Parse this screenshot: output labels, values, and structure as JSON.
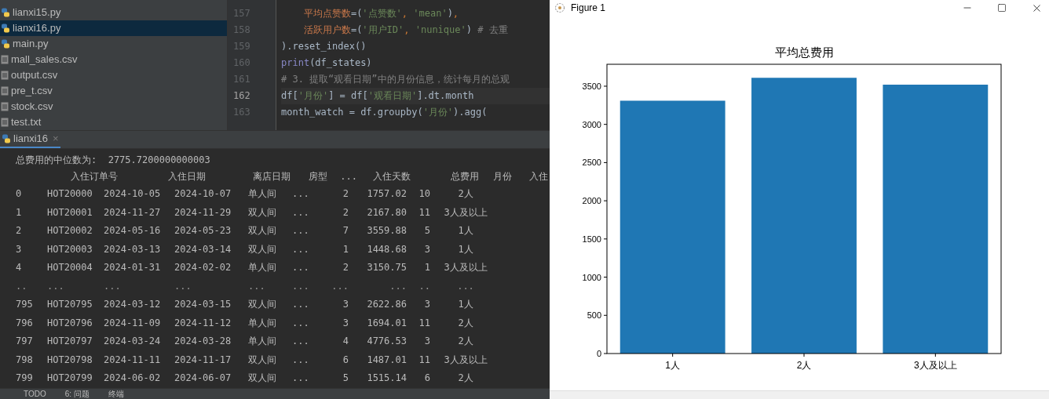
{
  "project_tree": {
    "items": [
      {
        "name": "lianxi15.py",
        "kind": "py",
        "selected": false
      },
      {
        "name": "lianxi16.py",
        "kind": "py",
        "selected": true
      },
      {
        "name": "main.py",
        "kind": "py",
        "selected": false
      },
      {
        "name": "mall_sales.csv",
        "kind": "file",
        "selected": false
      },
      {
        "name": "output.csv",
        "kind": "file",
        "selected": false
      },
      {
        "name": "pre_t.csv",
        "kind": "file",
        "selected": false
      },
      {
        "name": "stock.csv",
        "kind": "file",
        "selected": false
      },
      {
        "name": "test.txt",
        "kind": "file",
        "selected": false
      }
    ]
  },
  "editor": {
    "lines": [
      {
        "number": "157",
        "current": false,
        "tokens": [
          {
            "text": "    平均点赞数",
            "kind": "param"
          },
          {
            "text": "=(",
            "kind": "plain"
          },
          {
            "text": "'点赞数'",
            "kind": "str"
          },
          {
            "text": ", ",
            "kind": "punct"
          },
          {
            "text": "'mean'",
            "kind": "str"
          },
          {
            "text": ")",
            "kind": "plain"
          },
          {
            "text": ",",
            "kind": "punct"
          }
        ]
      },
      {
        "number": "158",
        "current": false,
        "tokens": [
          {
            "text": "    活跃用户数",
            "kind": "param"
          },
          {
            "text": "=(",
            "kind": "plain"
          },
          {
            "text": "'用户ID'",
            "kind": "str"
          },
          {
            "text": ", ",
            "kind": "punct"
          },
          {
            "text": "'nunique'",
            "kind": "str"
          },
          {
            "text": ")",
            "kind": "plain"
          },
          {
            "text": " # 去重",
            "kind": "comment"
          }
        ]
      },
      {
        "number": "159",
        "current": false,
        "tokens": [
          {
            "text": ").reset_index()",
            "kind": "plain"
          }
        ]
      },
      {
        "number": "160",
        "current": false,
        "tokens": [
          {
            "text": "print",
            "kind": "builtin"
          },
          {
            "text": "(df_states)",
            "kind": "plain"
          }
        ]
      },
      {
        "number": "161",
        "current": false,
        "tokens": [
          {
            "text": "# 3. 提取“观看日期”中的月份信息，统计每月的总观",
            "kind": "comment"
          }
        ]
      },
      {
        "number": "162",
        "current": true,
        "tokens": [
          {
            "text": "df[",
            "kind": "plain"
          },
          {
            "text": "'月份'",
            "kind": "str"
          },
          {
            "text": "] = df[",
            "kind": "plain"
          },
          {
            "text": "'观看日期'",
            "kind": "str"
          },
          {
            "text": "].dt.month",
            "kind": "plain"
          }
        ]
      },
      {
        "number": "163",
        "current": false,
        "tokens": [
          {
            "text": "month_watch = df.groupby(",
            "kind": "plain"
          },
          {
            "text": "'月份'",
            "kind": "str"
          },
          {
            "text": ").agg(",
            "kind": "plain"
          }
        ]
      }
    ]
  },
  "run_tab": {
    "label": "lianxi16",
    "close": "×"
  },
  "console": {
    "message": "总费用的中位数为:  2775.7200000000003",
    "header": [
      "入住订单号",
      "入住日期",
      "离店日期",
      "房型",
      "...",
      "入住天数",
      "总费用",
      "月份",
      "入住"
    ],
    "rows": [
      {
        "kind": "data",
        "cells": [
          "0",
          "HOT20000",
          "2024-10-05",
          "2024-10-07",
          "单人间",
          "...",
          "2",
          "1757.02",
          "10",
          "2人"
        ]
      },
      {
        "kind": "data",
        "cells": [
          "1",
          "HOT20001",
          "2024-11-27",
          "2024-11-29",
          "双人间",
          "...",
          "2",
          "2167.80",
          "11",
          "3人及以上"
        ]
      },
      {
        "kind": "data",
        "cells": [
          "2",
          "HOT20002",
          "2024-05-16",
          "2024-05-23",
          "双人间",
          "...",
          "7",
          "3559.88",
          "5",
          "1人"
        ]
      },
      {
        "kind": "data",
        "cells": [
          "3",
          "HOT20003",
          "2024-03-13",
          "2024-03-14",
          "双人间",
          "...",
          "1",
          "1448.68",
          "3",
          "1人"
        ]
      },
      {
        "kind": "data",
        "cells": [
          "4",
          "HOT20004",
          "2024-01-31",
          "2024-02-02",
          "单人间",
          "...",
          "2",
          "3150.75",
          "1",
          "3人及以上"
        ]
      },
      {
        "kind": "ellipsis",
        "cells": [
          "..",
          "...",
          "...",
          "...",
          "...",
          "...",
          "...",
          "...",
          "..",
          "..."
        ]
      },
      {
        "kind": "data",
        "cells": [
          "795",
          "HOT20795",
          "2024-03-12",
          "2024-03-15",
          "双人间",
          "...",
          "3",
          "2622.86",
          "3",
          "1人"
        ]
      },
      {
        "kind": "data",
        "cells": [
          "796",
          "HOT20796",
          "2024-11-09",
          "2024-11-12",
          "单人间",
          "...",
          "3",
          "1694.01",
          "11",
          "2人"
        ]
      },
      {
        "kind": "data",
        "cells": [
          "797",
          "HOT20797",
          "2024-03-24",
          "2024-03-28",
          "单人间",
          "...",
          "4",
          "4776.53",
          "3",
          "2人"
        ]
      },
      {
        "kind": "data",
        "cells": [
          "798",
          "HOT20798",
          "2024-11-11",
          "2024-11-17",
          "双人间",
          "...",
          "6",
          "1487.01",
          "11",
          "3人及以上"
        ]
      },
      {
        "kind": "data",
        "cells": [
          "799",
          "HOT20799",
          "2024-06-02",
          "2024-06-07",
          "双人间",
          "...",
          "5",
          "1515.14",
          "6",
          "2人"
        ]
      }
    ]
  },
  "bottom_toolbar": [
    "TODO",
    "6: 问题",
    "终端"
  ],
  "figure": {
    "title": "Figure 1",
    "chart_data": {
      "type": "bar",
      "title": "平均总费用",
      "categories": [
        "1人",
        "2人",
        "3人及以上"
      ],
      "series": [
        {
          "color": "#1f77b4",
          "values": [
            3310,
            3610,
            3520
          ]
        }
      ],
      "ylim": [
        0,
        3787
      ],
      "yticks": [
        0,
        500,
        1000,
        1500,
        2000,
        2500,
        3000,
        3500
      ]
    }
  }
}
